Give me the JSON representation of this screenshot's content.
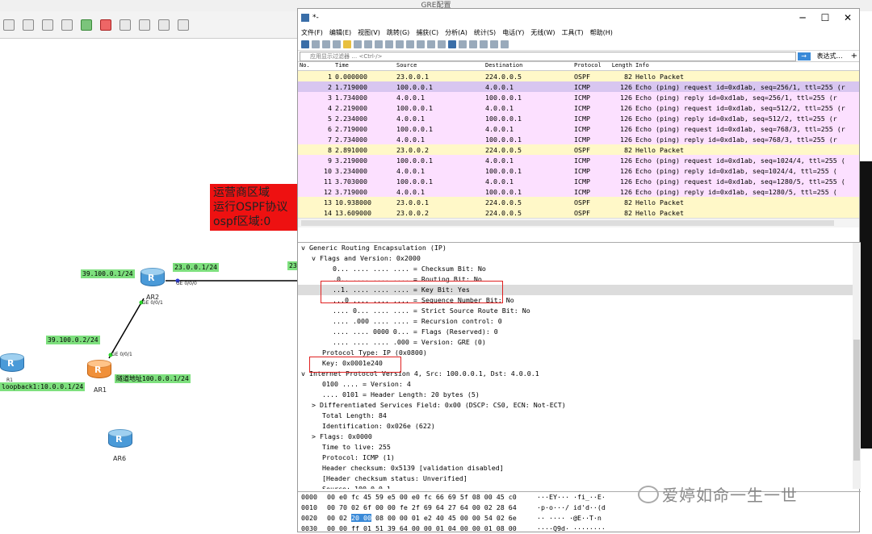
{
  "ensp": {
    "title": "GRE配置",
    "labels": {
      "net1": "39.100.0.1/24",
      "net2": "23.0.0.1/24",
      "net3": "39.100.0.2/24",
      "net_partial": "23",
      "ge000": "GE 0/0/0",
      "ge001_ar2": "GE 0/0/1",
      "ge001_ar1": "GE 0/0/1",
      "tunnel": "隧道地址100.0.0.1/24",
      "loopback": "loopback1:10.0.0.1/24"
    },
    "devices": {
      "ar2": "AR2",
      "ar1": "AR1",
      "ar6": "AR6",
      "r1": "R1"
    },
    "note": [
      "运营商区域",
      "运行OSPF协议",
      "ospf区域:0"
    ]
  },
  "wireshark": {
    "title": "*-",
    "menu": [
      "文件(F)",
      "编辑(E)",
      "视图(V)",
      "跳转(G)",
      "捕获(C)",
      "分析(A)",
      "统计(S)",
      "电话(Y)",
      "无线(W)",
      "工具(T)",
      "帮助(H)"
    ],
    "filter_placeholder": "应用显示过滤器 … <Ctrl-/>",
    "expression_label": "表达式…",
    "columns": [
      "No.",
      "Time",
      "Source",
      "Destination",
      "Protocol",
      "Length",
      "Info"
    ],
    "packets": [
      {
        "no": "1",
        "time": "0.000000",
        "src": "23.0.0.1",
        "dst": "224.0.0.5",
        "proto": "OSPF",
        "len": "82",
        "info": "Hello Packet",
        "type": "ospf"
      },
      {
        "no": "2",
        "time": "1.719000",
        "src": "100.0.0.1",
        "dst": "4.0.0.1",
        "proto": "ICMP",
        "len": "126",
        "info": "Echo (ping) request  id=0xd1ab, seq=256/1, ttl=255 (r",
        "type": "sel"
      },
      {
        "no": "3",
        "time": "1.734000",
        "src": "4.0.0.1",
        "dst": "100.0.0.1",
        "proto": "ICMP",
        "len": "126",
        "info": "Echo (ping) reply    id=0xd1ab, seq=256/1, ttl=255 (r",
        "type": "icmp"
      },
      {
        "no": "4",
        "time": "2.219000",
        "src": "100.0.0.1",
        "dst": "4.0.0.1",
        "proto": "ICMP",
        "len": "126",
        "info": "Echo (ping) request  id=0xd1ab, seq=512/2, ttl=255 (r",
        "type": "icmp"
      },
      {
        "no": "5",
        "time": "2.234000",
        "src": "4.0.0.1",
        "dst": "100.0.0.1",
        "proto": "ICMP",
        "len": "126",
        "info": "Echo (ping) reply    id=0xd1ab, seq=512/2, ttl=255 (r",
        "type": "icmp"
      },
      {
        "no": "6",
        "time": "2.719000",
        "src": "100.0.0.1",
        "dst": "4.0.0.1",
        "proto": "ICMP",
        "len": "126",
        "info": "Echo (ping) request  id=0xd1ab, seq=768/3, ttl=255 (r",
        "type": "icmp"
      },
      {
        "no": "7",
        "time": "2.734000",
        "src": "4.0.0.1",
        "dst": "100.0.0.1",
        "proto": "ICMP",
        "len": "126",
        "info": "Echo (ping) reply    id=0xd1ab, seq=768/3, ttl=255 (r",
        "type": "icmp"
      },
      {
        "no": "8",
        "time": "2.891000",
        "src": "23.0.0.2",
        "dst": "224.0.0.5",
        "proto": "OSPF",
        "len": "82",
        "info": "Hello Packet",
        "type": "ospf"
      },
      {
        "no": "9",
        "time": "3.219000",
        "src": "100.0.0.1",
        "dst": "4.0.0.1",
        "proto": "ICMP",
        "len": "126",
        "info": "Echo (ping) request  id=0xd1ab, seq=1024/4, ttl=255 (",
        "type": "icmp"
      },
      {
        "no": "10",
        "time": "3.234000",
        "src": "4.0.0.1",
        "dst": "100.0.0.1",
        "proto": "ICMP",
        "len": "126",
        "info": "Echo (ping) reply    id=0xd1ab, seq=1024/4, ttl=255 (",
        "type": "icmp"
      },
      {
        "no": "11",
        "time": "3.703000",
        "src": "100.0.0.1",
        "dst": "4.0.0.1",
        "proto": "ICMP",
        "len": "126",
        "info": "Echo (ping) request  id=0xd1ab, seq=1280/5, ttl=255 (",
        "type": "icmp"
      },
      {
        "no": "12",
        "time": "3.719000",
        "src": "4.0.0.1",
        "dst": "100.0.0.1",
        "proto": "ICMP",
        "len": "126",
        "info": "Echo (ping) reply    id=0xd1ab, seq=1280/5, ttl=255 (",
        "type": "icmp"
      },
      {
        "no": "13",
        "time": "10.938000",
        "src": "23.0.0.1",
        "dst": "224.0.0.5",
        "proto": "OSPF",
        "len": "82",
        "info": "Hello Packet",
        "type": "ospf"
      },
      {
        "no": "14",
        "time": "13.609000",
        "src": "23.0.0.2",
        "dst": "224.0.0.5",
        "proto": "OSPF",
        "len": "82",
        "info": "Hello Packet",
        "type": "ospf"
      }
    ],
    "details": [
      {
        "text": "v Generic Routing Encapsulation (IP)",
        "indent": 0
      },
      {
        "text": "v Flags and Version: 0x2000",
        "indent": 1
      },
      {
        "text": "0... .... .... .... = Checksum Bit: No",
        "indent": 3
      },
      {
        "text": ".0.. .... .... .... = Routing Bit: No",
        "indent": 3
      },
      {
        "text": "..1. .... .... .... = Key Bit: Yes",
        "indent": 3,
        "hl": true
      },
      {
        "text": "...0 .... .... .... = Sequence Number Bit: No",
        "indent": 3
      },
      {
        "text": ".... 0... .... .... = Strict Source Route Bit: No",
        "indent": 3
      },
      {
        "text": ".... .000 .... .... = Recursion control: 0",
        "indent": 3
      },
      {
        "text": ".... .... 0000 0... = Flags (Reserved): 0",
        "indent": 3
      },
      {
        "text": ".... .... .... .000 = Version: GRE (0)",
        "indent": 3
      },
      {
        "text": "Protocol Type: IP (0x0800)",
        "indent": 2
      },
      {
        "text": "Key: 0x0001e240",
        "indent": 2
      },
      {
        "text": "v Internet Protocol Version 4, Src: 100.0.0.1, Dst: 4.0.0.1",
        "indent": 0
      },
      {
        "text": "0100 .... = Version: 4",
        "indent": 2
      },
      {
        "text": ".... 0101 = Header Length: 20 bytes (5)",
        "indent": 2
      },
      {
        "text": "> Differentiated Services Field: 0x00 (DSCP: CS0, ECN: Not-ECT)",
        "indent": 1
      },
      {
        "text": "Total Length: 84",
        "indent": 2
      },
      {
        "text": "Identification: 0x026e (622)",
        "indent": 2
      },
      {
        "text": "> Flags: 0x0000",
        "indent": 1
      },
      {
        "text": "Time to live: 255",
        "indent": 2
      },
      {
        "text": "Protocol: ICMP (1)",
        "indent": 2
      },
      {
        "text": "Header checksum: 0x5139 [validation disabled]",
        "indent": 2
      },
      {
        "text": "[Header checksum status: Unverified]",
        "indent": 2
      },
      {
        "text": "Source: 100.0.0.1",
        "indent": 2
      }
    ],
    "bytes": [
      {
        "off": "0000",
        "hex": "00 e0 fc 45 59 e5 00 e0  fc 66 69 5f 08 00 45 c0",
        "ascii": "···EY··· ·fi_··E·"
      },
      {
        "off": "0010",
        "hex": "00 70 02 6f 00 00 fe 2f  69 64 27 64 00 02 28 64",
        "ascii": "·p·o···/ id'd··(d"
      },
      {
        "off": "0020",
        "hex_a": "00 02 ",
        "hex_sel": "20 00",
        "hex_b": " 08 00 00 01  e2 40 45 00 00 54 02 6e",
        "ascii": "·· ···· ·@E··T·n"
      },
      {
        "off": "0030",
        "hex": "00 00 ff 01 51 39 64 00  00 01 04 00 00 01 08 00",
        "ascii": "····Q9d· ········"
      }
    ]
  },
  "watermark": "爱婷如命一生一世"
}
